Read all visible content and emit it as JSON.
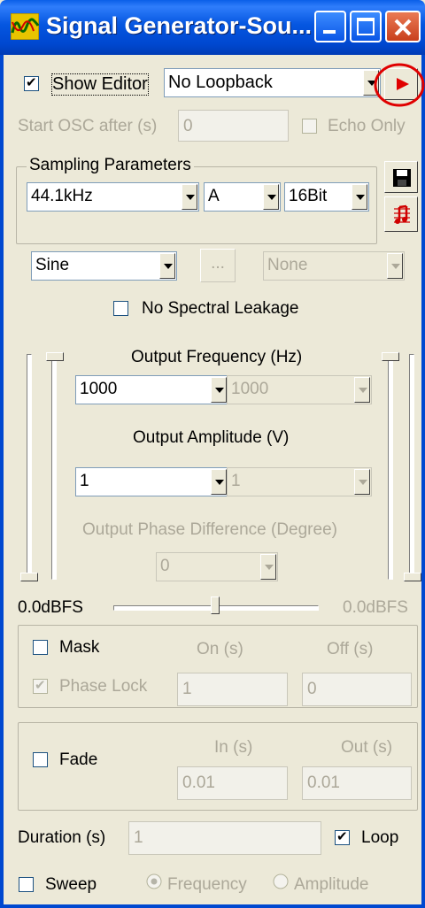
{
  "window": {
    "title": "Signal Generator-Sou..."
  },
  "top": {
    "show_editor_label": "Show Editor",
    "show_editor_checked": true,
    "loopback_value": "No Loopback",
    "start_osc_label": "Start OSC after (s)",
    "start_osc_value": "0",
    "echo_only_label": "Echo Only"
  },
  "sampling": {
    "title": "Sampling Parameters",
    "rate": "44.1kHz",
    "channel": "A",
    "bits": "16Bit"
  },
  "waveform": {
    "type": "Sine",
    "browse_label": "...",
    "secondary": "None",
    "no_leakage_label": "No Spectral Leakage"
  },
  "output": {
    "freq_label": "Output Frequency (Hz)",
    "freq_value": "1000",
    "freq_value2": "1000",
    "amp_label": "Output Amplitude (V)",
    "amp_value": "1",
    "amp_value2": "1",
    "phase_label": "Output Phase Difference (Degree)",
    "phase_value": "0",
    "left_level": "0.0dBFS",
    "right_level": "0.0dBFS"
  },
  "mask": {
    "mask_label": "Mask",
    "on_label": "On (s)",
    "off_label": "Off (s)",
    "phase_lock_label": "Phase Lock",
    "on_value": "1",
    "off_value": "0"
  },
  "fade": {
    "fade_label": "Fade",
    "in_label": "In (s)",
    "out_label": "Out (s)",
    "in_value": "0.01",
    "out_value": "0.01"
  },
  "duration": {
    "label": "Duration (s)",
    "value": "1",
    "loop_label": "Loop",
    "loop_checked": true
  },
  "sweep": {
    "label": "Sweep",
    "frequency_label": "Frequency",
    "amplitude_label": "Amplitude"
  },
  "colors": {
    "accent_red": "#e00000",
    "title_blue": "#0048d0"
  }
}
